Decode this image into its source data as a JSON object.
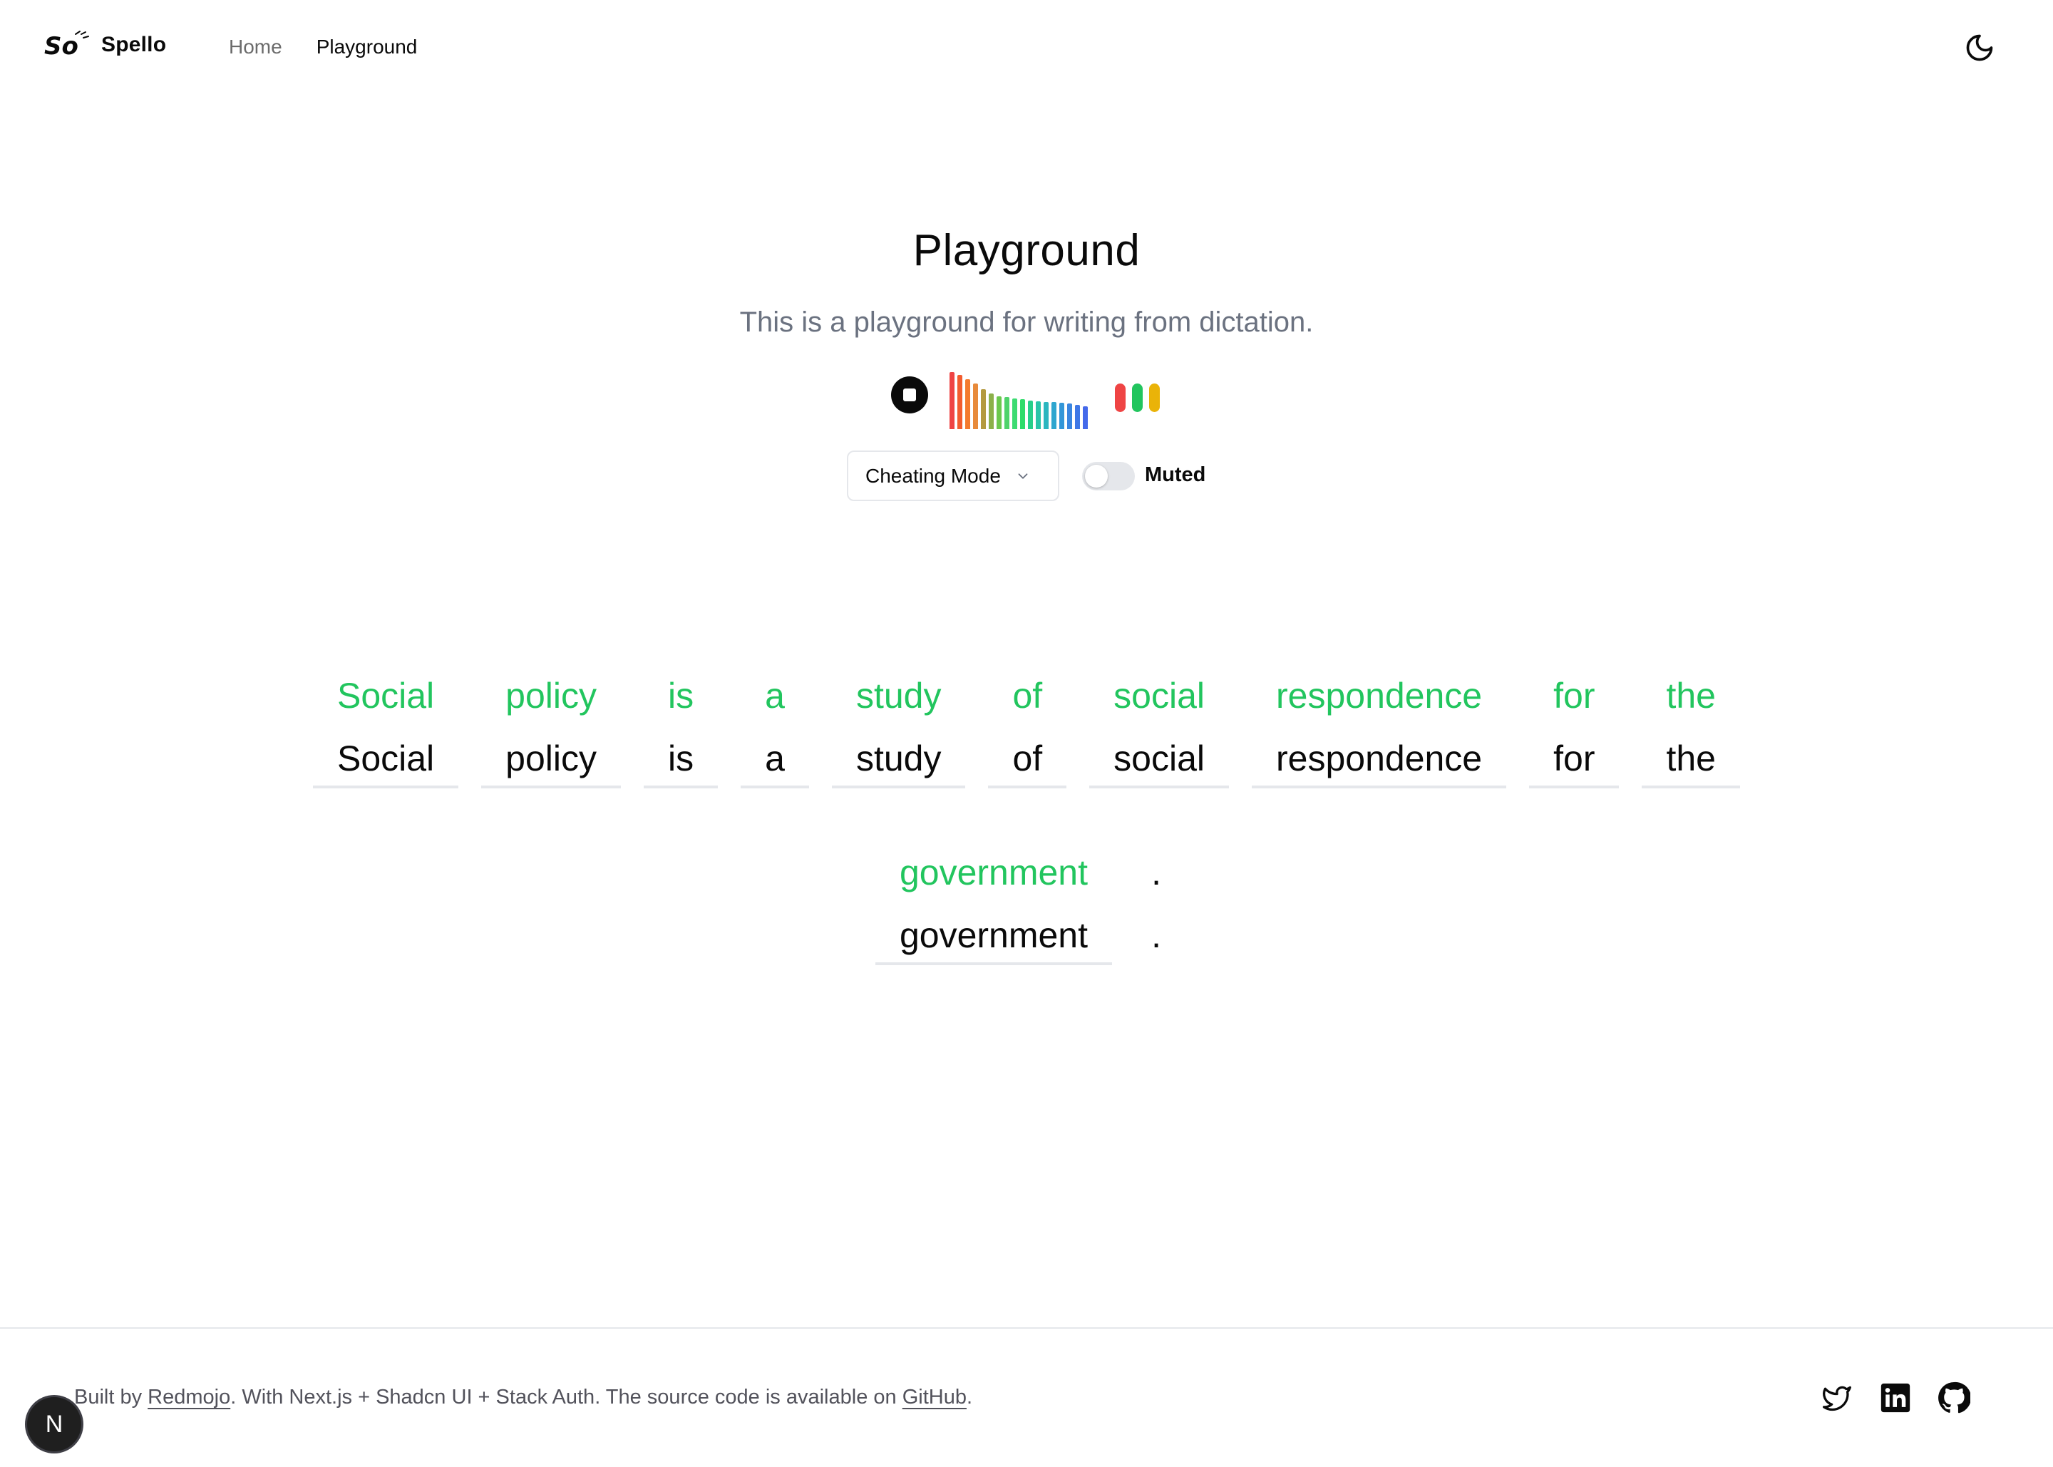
{
  "header": {
    "brand": "Spello",
    "nav": [
      {
        "label": "Home",
        "active": false
      },
      {
        "label": "Playground",
        "active": true
      }
    ],
    "theme_toggle_icon": "moon-icon"
  },
  "hero": {
    "title": "Playground",
    "subtitle": "This is a playground for writing from dictation."
  },
  "player": {
    "stop_icon": "stop-icon",
    "waveform_levels": [
      1.0,
      0.95,
      0.88,
      0.8,
      0.7,
      0.62,
      0.58,
      0.56,
      0.54,
      0.52,
      0.5,
      0.49,
      0.48,
      0.47,
      0.46,
      0.45,
      0.42,
      0.4
    ],
    "waveform_colors": [
      "#ef4444",
      "#f25c2f",
      "#f47a2e",
      "#e88a3a",
      "#b49a3f",
      "#8cb04a",
      "#6cc84e",
      "#4fd36a",
      "#3ddb72",
      "#2fdc6a",
      "#28cf8a",
      "#2ac4a8",
      "#2bb6bf",
      "#2ea6cf",
      "#3396d8",
      "#3a86e0",
      "#3f78e6",
      "#4469ea"
    ],
    "status_pills": [
      "#ef4444",
      "#22c55e",
      "#eab308"
    ]
  },
  "controls": {
    "mode_value": "Cheating Mode",
    "muted_label": "Muted",
    "muted_on": false
  },
  "words": {
    "row1": [
      {
        "hint": "Social",
        "answer": "Social"
      },
      {
        "hint": "policy",
        "answer": "policy"
      },
      {
        "hint": "is",
        "answer": "is"
      },
      {
        "hint": "a",
        "answer": "a"
      },
      {
        "hint": "study",
        "answer": "study"
      },
      {
        "hint": "of",
        "answer": "of"
      },
      {
        "hint": "social",
        "answer": "social"
      },
      {
        "hint": "respondence",
        "answer": "respondence"
      },
      {
        "hint": "for",
        "answer": "for"
      },
      {
        "hint": "the",
        "answer": "the"
      }
    ],
    "row2": [
      {
        "hint": "government",
        "answer": "government"
      },
      {
        "hint": ".",
        "answer": ".",
        "punct": true
      }
    ]
  },
  "footer": {
    "prefix": "Built by ",
    "author": "Redmojo",
    "middle": ". With Next.js + Shadcn UI + Stack Auth. The source code is available on ",
    "repo": "GitHub",
    "suffix": ".",
    "socials": [
      "twitter-icon",
      "linkedin-icon",
      "github-icon"
    ],
    "badge": "N"
  },
  "colors": {
    "hint_green": "#22c55e",
    "muted_text": "#6b7280",
    "border": "#e5e7eb"
  }
}
